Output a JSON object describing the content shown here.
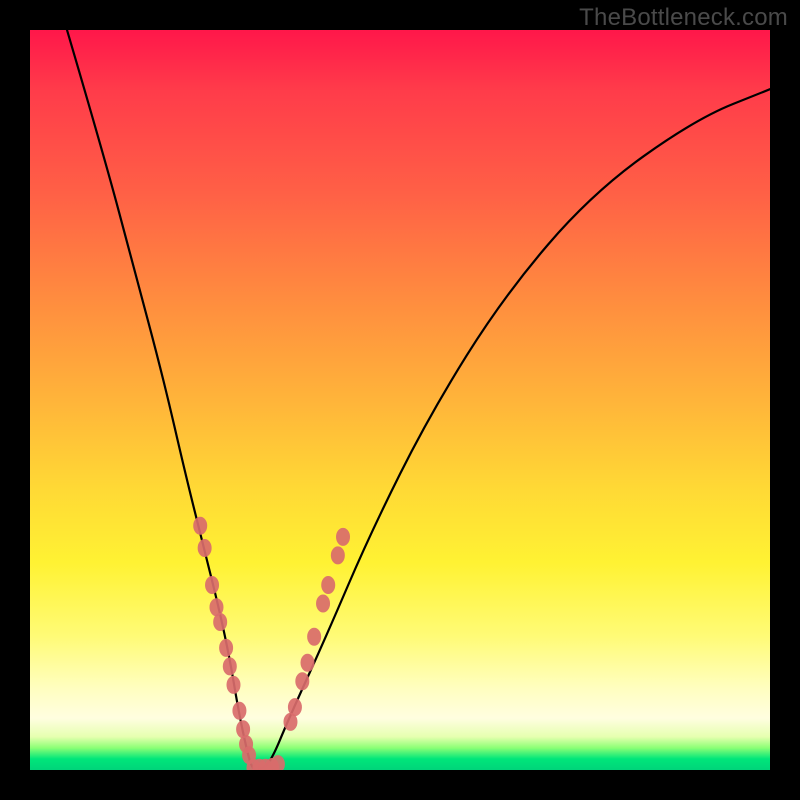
{
  "watermark": "TheBottleneck.com",
  "chart_data": {
    "type": "line",
    "title": "",
    "xlabel": "",
    "ylabel": "",
    "xlim": [
      0,
      100
    ],
    "ylim": [
      0,
      100
    ],
    "grid": false,
    "legend": false,
    "annotations": [
      "TheBottleneck.com"
    ],
    "series": [
      {
        "name": "bottleneck-curve",
        "x": [
          5,
          10,
          14,
          18,
          21,
          23.5,
          25.5,
          27,
          28,
          29,
          30,
          31,
          32.5,
          35,
          40,
          46,
          54,
          64,
          76,
          90,
          100
        ],
        "y": [
          100,
          83,
          68,
          53,
          40,
          30,
          22,
          15,
          9,
          4,
          0,
          0,
          1,
          7,
          18,
          32,
          48,
          64,
          78,
          88,
          92
        ]
      }
    ],
    "markers": [
      {
        "name": "curve-dots-left",
        "color": "#d96b6b",
        "points": [
          {
            "x": 23.0,
            "y": 33.0
          },
          {
            "x": 23.6,
            "y": 30.0
          },
          {
            "x": 24.6,
            "y": 25.0
          },
          {
            "x": 25.2,
            "y": 22.0
          },
          {
            "x": 25.7,
            "y": 20.0
          },
          {
            "x": 26.5,
            "y": 16.5
          },
          {
            "x": 27.0,
            "y": 14.0
          },
          {
            "x": 27.5,
            "y": 11.5
          },
          {
            "x": 28.3,
            "y": 8.0
          },
          {
            "x": 28.8,
            "y": 5.5
          },
          {
            "x": 29.2,
            "y": 3.5
          },
          {
            "x": 29.6,
            "y": 2.0
          }
        ]
      },
      {
        "name": "curve-dots-bottom",
        "color": "#d96b6b",
        "points": [
          {
            "x": 30.2,
            "y": 0.3
          },
          {
            "x": 31.0,
            "y": 0.3
          },
          {
            "x": 31.8,
            "y": 0.3
          },
          {
            "x": 32.7,
            "y": 0.4
          },
          {
            "x": 33.5,
            "y": 0.8
          }
        ]
      },
      {
        "name": "curve-dots-right",
        "color": "#d96b6b",
        "points": [
          {
            "x": 35.2,
            "y": 6.5
          },
          {
            "x": 35.8,
            "y": 8.5
          },
          {
            "x": 36.8,
            "y": 12.0
          },
          {
            "x": 37.5,
            "y": 14.5
          },
          {
            "x": 38.4,
            "y": 18.0
          },
          {
            "x": 39.6,
            "y": 22.5
          },
          {
            "x": 40.3,
            "y": 25.0
          },
          {
            "x": 41.6,
            "y": 29.0
          },
          {
            "x": 42.3,
            "y": 31.5
          }
        ]
      }
    ]
  }
}
